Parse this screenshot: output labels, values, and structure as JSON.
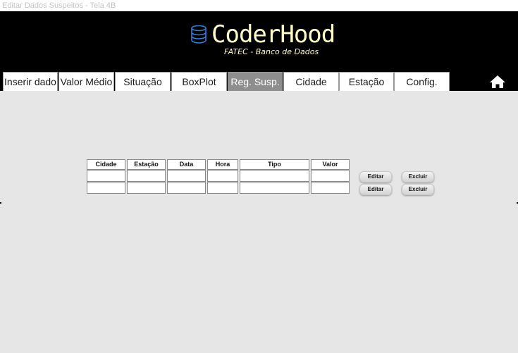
{
  "window": {
    "title": "Editar Dados Suspeitos - Tela 4B"
  },
  "logo": {
    "title": "CoderHood",
    "subtitle": "FATEC - Banco de Dados"
  },
  "tabs": [
    {
      "label": "Inserir dado"
    },
    {
      "label": "Valor Médio"
    },
    {
      "label": "Situação"
    },
    {
      "label": "BoxPlot"
    },
    {
      "label": "Reg. Susp."
    },
    {
      "label": "Cidade"
    },
    {
      "label": "Estação"
    },
    {
      "label": "Config."
    }
  ],
  "active_tab": "Reg. Susp.",
  "table": {
    "headers": [
      "Cidade",
      "Estação",
      "Data",
      "Hora",
      "Tipo",
      "Valor"
    ],
    "rows": [
      [
        "",
        "",
        "",
        "",
        "",
        ""
      ],
      [
        "",
        "",
        "",
        "",
        "",
        ""
      ]
    ]
  },
  "actions": {
    "edit_label": "Editar",
    "delete_label": "Excluir"
  },
  "colors": {
    "header_bg": "#000000",
    "logo": "#fffcc8",
    "active_tab": "#8e8e8e",
    "page_bg": "#e6e6e6"
  }
}
